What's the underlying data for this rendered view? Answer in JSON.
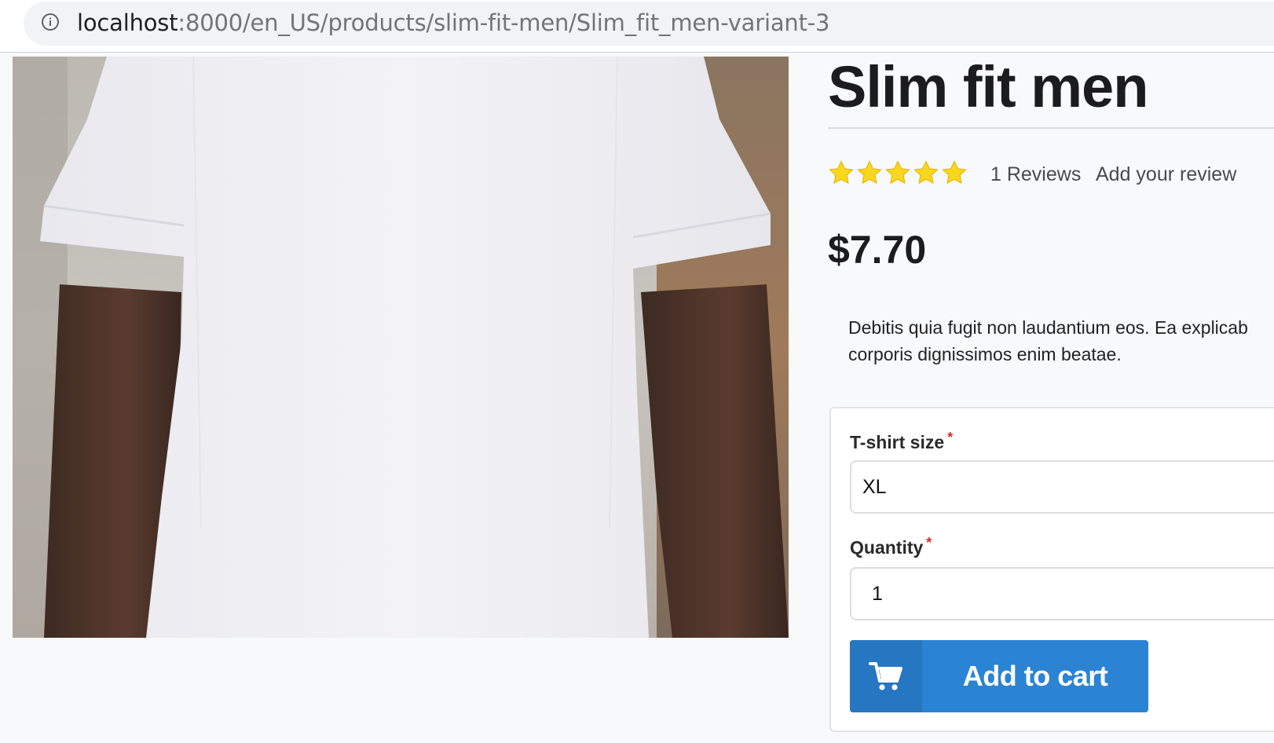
{
  "browser": {
    "url_host": "localhost",
    "url_path": ":8000/en_US/products/slim-fit-men/Slim_fit_men-variant-3"
  },
  "product": {
    "image_icon": "tshirt-photo",
    "title": "Slim fit men",
    "rating_stars": 5,
    "rating_max": 5,
    "star_color": "#f9d71c",
    "reviews_label": "1 Reviews",
    "add_review_label": "Add your review",
    "price": "$7.70",
    "description": "Debitis quia fugit non laudantium eos. Ea explicab",
    "description_line2": "corporis dignissimos enim beatae."
  },
  "form": {
    "size_label": "T-shirt size",
    "size_value": "XL",
    "quantity_label": "Quantity",
    "quantity_value": "1",
    "required_mark": "*",
    "add_to_cart_label": "Add to cart",
    "add_to_cart_icon": "cart-icon",
    "button_color": "#2b84d3"
  }
}
